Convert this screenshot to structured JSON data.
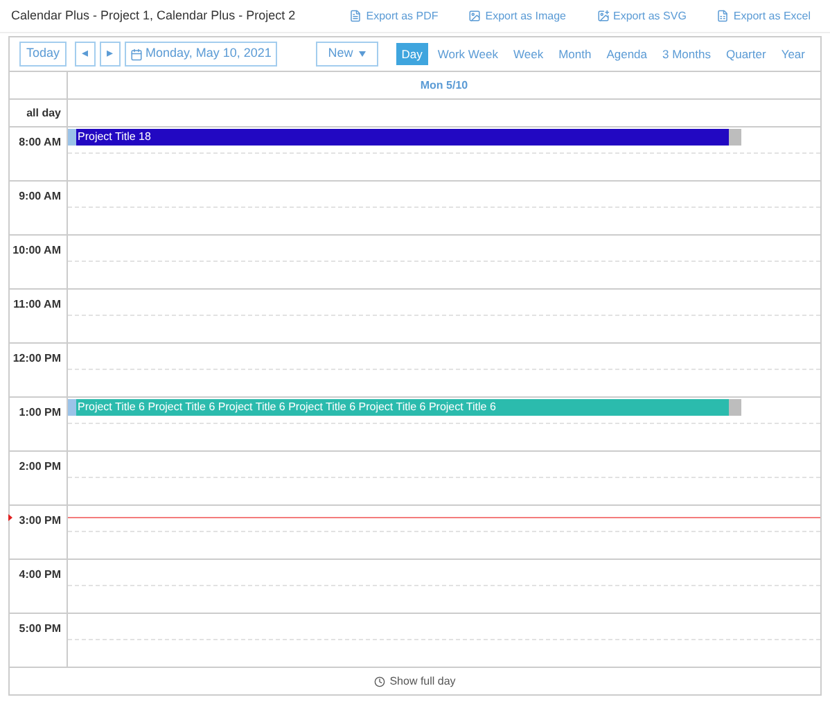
{
  "window": {
    "title": "Calendar Plus - Project 1, Calendar Plus - Project 2"
  },
  "exports": [
    {
      "label": "Export as PDF",
      "kind": "pdf"
    },
    {
      "label": "Export as Image",
      "kind": "image"
    },
    {
      "label": "Export as SVG",
      "kind": "svg"
    },
    {
      "label": "Export as Excel",
      "kind": "excel"
    }
  ],
  "toolbar": {
    "today": "Today",
    "prev": "◂",
    "next": "▸",
    "date": "Monday, May 10, 2021",
    "new": "New"
  },
  "views": [
    {
      "label": "Day",
      "selected": true
    },
    {
      "label": "Work Week",
      "selected": false
    },
    {
      "label": "Week",
      "selected": false
    },
    {
      "label": "Month",
      "selected": false
    },
    {
      "label": "Agenda",
      "selected": false
    },
    {
      "label": "3 Months",
      "selected": false
    },
    {
      "label": "Quarter",
      "selected": false
    },
    {
      "label": "Year",
      "selected": false
    }
  ],
  "day_header": "Mon 5/10",
  "all_day_label": "all day",
  "hours": [
    {
      "label": "8:00 AM",
      "events": [
        {
          "title": "Project Title 18",
          "color": "#2208c2"
        }
      ]
    },
    {
      "label": "9:00 AM"
    },
    {
      "label": "10:00 AM"
    },
    {
      "label": "11:00 AM"
    },
    {
      "label": "12:00 PM"
    },
    {
      "label": "1:00 PM",
      "events": [
        {
          "title": "Project Title 6 Project Title 6 Project Title 6 Project Title 6 Project Title 6 Project Title 6",
          "color": "#2bbbad"
        }
      ]
    },
    {
      "label": "2:00 PM"
    },
    {
      "label": "3:00 PM",
      "current_time": true
    },
    {
      "label": "4:00 PM"
    },
    {
      "label": "5:00 PM"
    }
  ],
  "footer": "Show full day"
}
